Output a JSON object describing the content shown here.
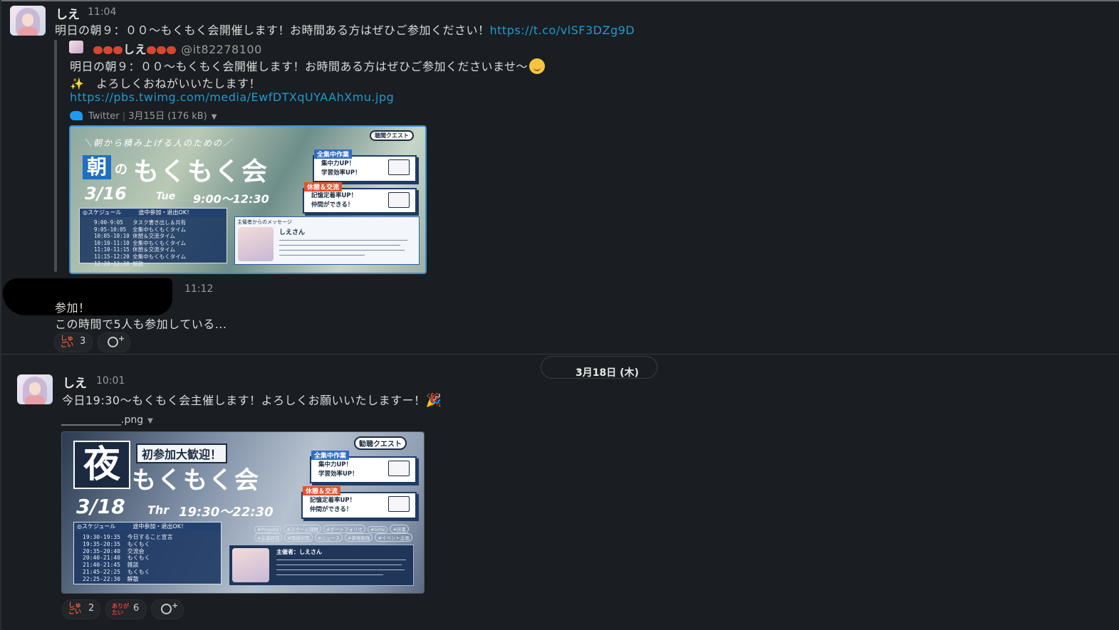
{
  "msg1": {
    "author": "しえ",
    "time": "11:04",
    "text": "明日の朝９：００〜もくもく会開催します！お時間ある方はぜひご参加ください！",
    "link": "https://t.co/vlSF3DZg9D"
  },
  "tweet": {
    "display_name": "しえ",
    "handle": "@it82278100",
    "line1": "明日の朝９：００〜もくもく会開催します！お時間ある方はぜひご参加くださいませ〜",
    "line2": "よろしくおねがいいたします！",
    "image_link": "https://pbs.twimg.com/media/EwfDTXqUYAAhXmu.jpg",
    "source": "Twitter",
    "date": "3月15日",
    "size": "(176 kB)"
  },
  "poster1": {
    "subtitle": "＼朝から積み上げる人のための／",
    "big_kanji": "朝",
    "small": "の",
    "title": "もくもく会",
    "date": "3/16",
    "day": "Tue",
    "hours": "9:00〜12:30",
    "badge": "聴聞クエスト",
    "schedule_head": "◎スケジュール　　　途中参加・退出OK！",
    "schedule_rows": "9:00-9:05   タスク書き出し＆共有\n9:05-10:05  全集中もくもくタイム\n10:05-10:10 休憩＆交流タイム\n10:10-11:10 全集中もくもくタイム\n11:10-11:15 休憩＆交流タイム\n11:15-12:20 全集中もくもくタイム\n12:20-12:30 解散",
    "card1_head": "全集中作業",
    "card1_l1": "集中力UP！",
    "card1_l2": "学習効率UP！",
    "card2_head": "休憩＆交流",
    "card2_l1": "記憶定着率UP！",
    "card2_l2": "仲間ができる！",
    "msg_head": "主催者からのメッセージ",
    "msg_name": "しえさん"
  },
  "msg2": {
    "time": "11:12",
    "line1": "参加！",
    "line2": "この時間で5人も参加している..."
  },
  "reactions1": [
    {
      "emoji": "しゅごい",
      "count": "3"
    }
  ],
  "date_divider": "3月18日 (木)",
  "msg3": {
    "author": "しえ",
    "time": "10:01",
    "text": "今日19:30〜もくもく会主催します！よろしくお願いいたしますー！",
    "file_name": "____________.png"
  },
  "poster2": {
    "big_kanji": "夜",
    "banner": "初参加大歓迎！",
    "title": "もくもく会",
    "date": "3/18",
    "day": "Thr",
    "hours": "19:30〜22:30",
    "badge": "勧聴クエスト",
    "schedule_head": "◎スケジュール　　　途中参加・退出OK！",
    "schedule_rows": "19:30-19:35  今日すること宣言\n19:35-20:35  もくもく\n20:35-20:40  交流会\n20:40-21:40  もくもく\n21:40-21:45  雑談\n21:45-22:25  もくもく\n22:25-22:30  解散",
    "card1_head": "全集中作業",
    "card1_l1": "集中力UP！",
    "card1_l2": "学習効率UP！",
    "card2_head": "休憩＆交流",
    "card2_l1": "記憶定着率UP！",
    "card2_l2": "仲間ができる！",
    "tags_row1": [
      "#Progate",
      "#スクール課題",
      "#ポートフォリオ",
      "#Gitle",
      "#読書"
    ],
    "tags_row2": [
      "#企業研究",
      "#面接対策",
      "#ニュース",
      "#資格勉強",
      "#イベント企画"
    ],
    "msg_name": "主催者：しえさん"
  },
  "reactions2": [
    {
      "emoji": "しゅごい",
      "count": "2"
    },
    {
      "emoji": "ありがたい",
      "count": "6"
    }
  ],
  "colors": {
    "background": "#1a1d21",
    "link": "#1d9bd1",
    "reaction_text": "#e8603c"
  }
}
